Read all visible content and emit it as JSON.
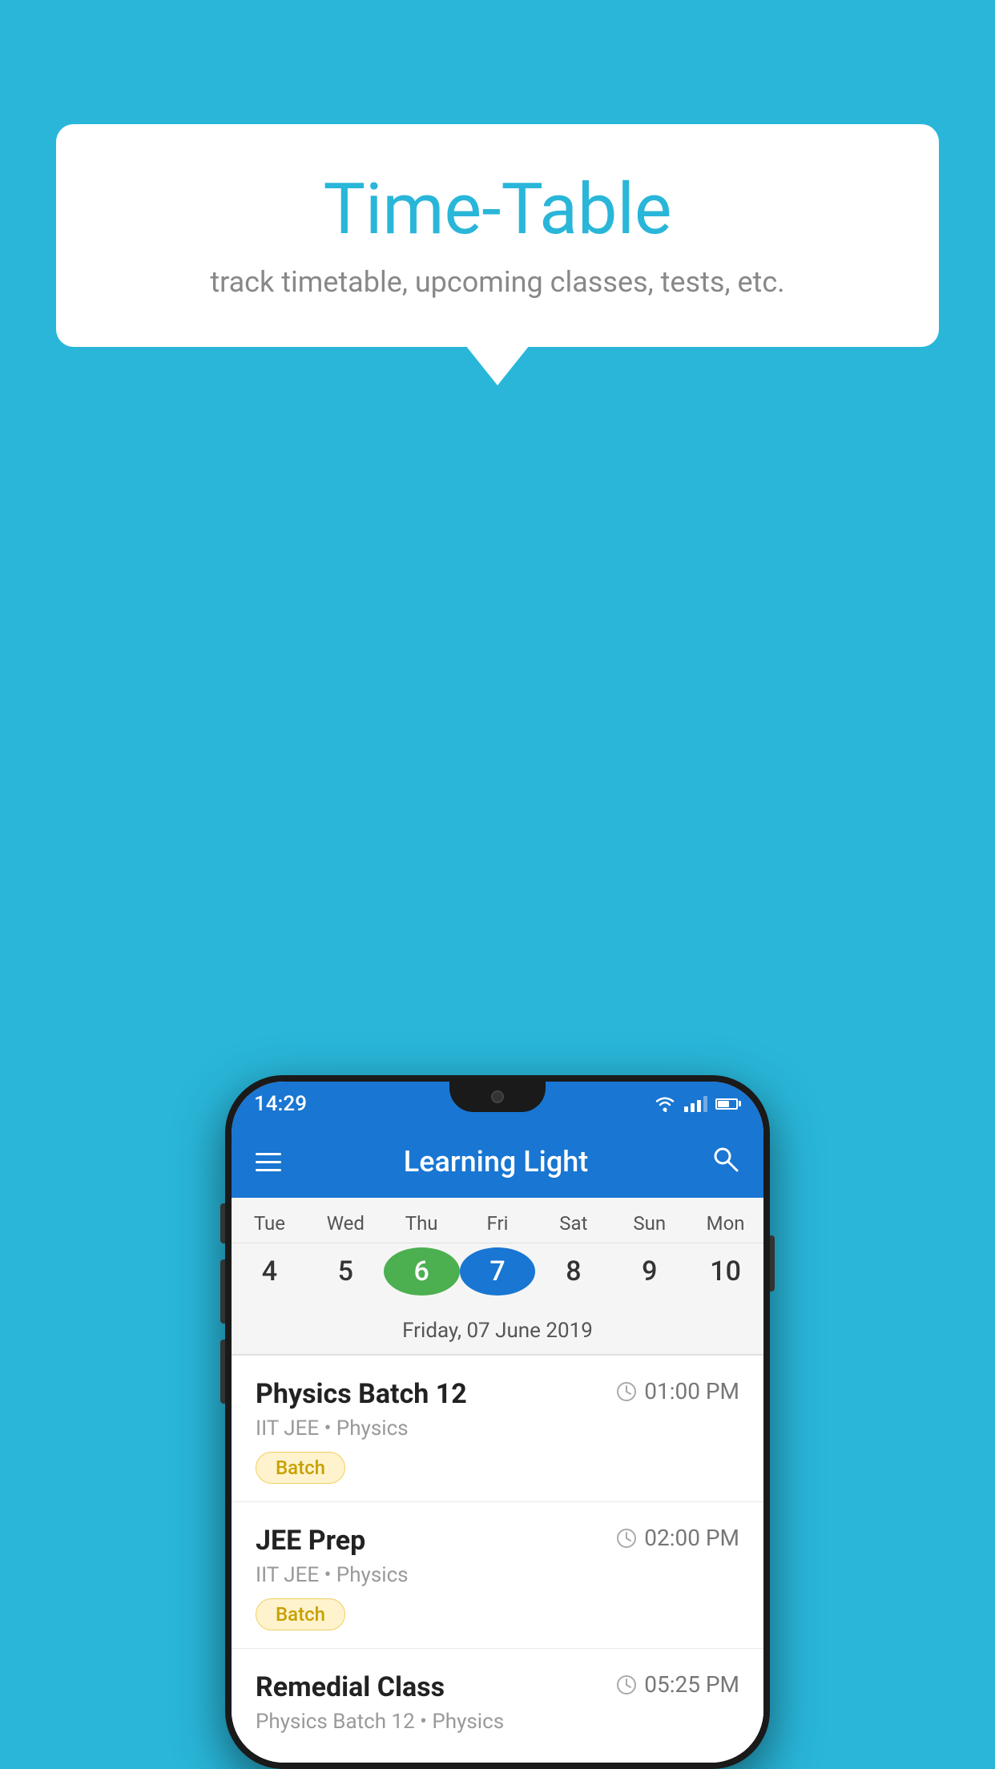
{
  "background_color": "#29b6d9",
  "speech_bubble": {
    "title": "Time-Table",
    "subtitle": "track timetable, upcoming classes, tests, etc."
  },
  "phone": {
    "status_bar": {
      "time": "14:29"
    },
    "app_bar": {
      "title": "Learning Light"
    },
    "calendar": {
      "days": [
        {
          "name": "Tue",
          "number": "4",
          "state": "normal"
        },
        {
          "name": "Wed",
          "number": "5",
          "state": "normal"
        },
        {
          "name": "Thu",
          "number": "6",
          "state": "today"
        },
        {
          "name": "Fri",
          "number": "7",
          "state": "selected"
        },
        {
          "name": "Sat",
          "number": "8",
          "state": "normal"
        },
        {
          "name": "Sun",
          "number": "9",
          "state": "normal"
        },
        {
          "name": "Mon",
          "number": "10",
          "state": "normal"
        }
      ],
      "selected_date_label": "Friday, 07 June 2019"
    },
    "schedule_items": [
      {
        "title": "Physics Batch 12",
        "time": "01:00 PM",
        "subtitle": "IIT JEE • Physics",
        "tag": "Batch"
      },
      {
        "title": "JEE Prep",
        "time": "02:00 PM",
        "subtitle": "IIT JEE • Physics",
        "tag": "Batch"
      },
      {
        "title": "Remedial Class",
        "time": "05:25 PM",
        "subtitle": "Physics Batch 12 • Physics",
        "tag": null
      }
    ]
  }
}
